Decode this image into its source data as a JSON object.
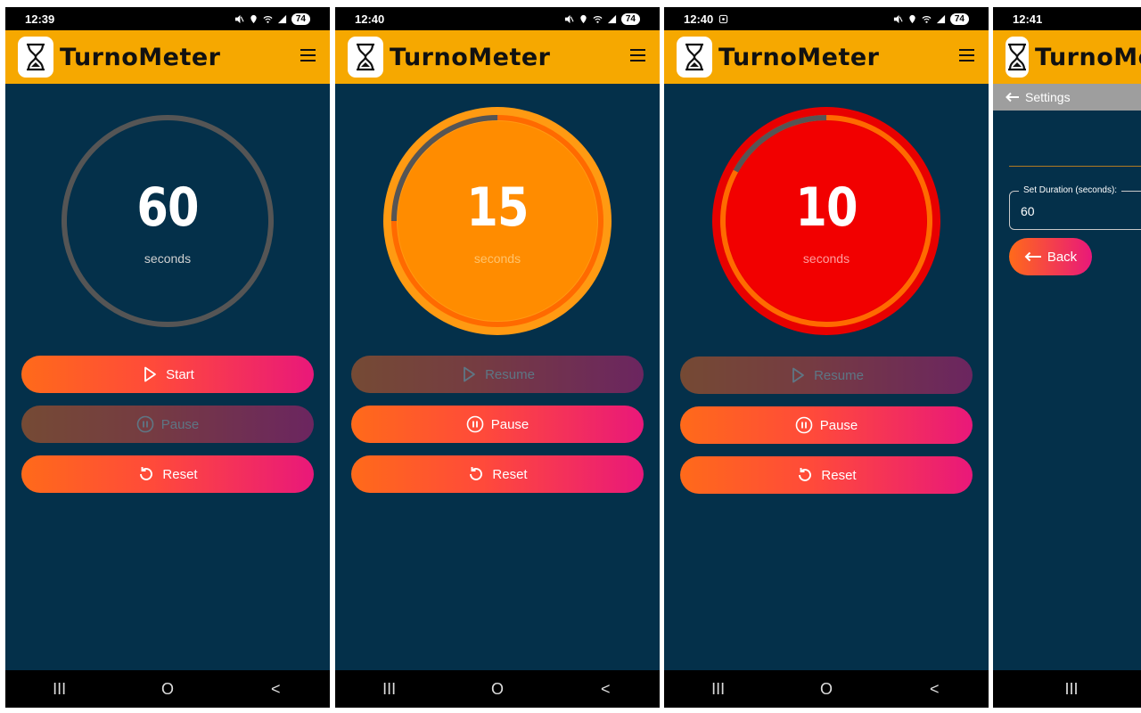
{
  "app_title": "TurnoMeter",
  "colors": {
    "background": "#04304a",
    "appbar": "#f6a800",
    "orange_state": "#ff8c00",
    "red_state": "#f20000",
    "track_gray": "#555555"
  },
  "screens": [
    {
      "status_time": "12:39",
      "battery": "74",
      "timer": {
        "value": "60",
        "unit": "seconds",
        "state": "idle",
        "progress_remaining": 1.0
      },
      "buttons": {
        "primary_label": "Start",
        "primary_icon": "play-icon",
        "pause_label": "Pause",
        "reset_label": "Reset"
      }
    },
    {
      "status_time": "12:40",
      "battery": "74",
      "timer": {
        "value": "15",
        "unit": "seconds",
        "state": "warning",
        "progress_remaining": 0.25
      },
      "buttons": {
        "primary_label": "Resume",
        "primary_icon": "play-icon",
        "pause_label": "Pause",
        "reset_label": "Reset"
      }
    },
    {
      "status_time": "12:40",
      "battery": "74",
      "timer": {
        "value": "10",
        "unit": "seconds",
        "state": "danger",
        "progress_remaining": 0.17
      },
      "buttons": {
        "primary_label": "Resume",
        "primary_icon": "play-icon",
        "pause_label": "Pause",
        "reset_label": "Reset"
      }
    },
    {
      "status_time": "12:41",
      "settings_title": "Settings",
      "duration_label": "Set Duration (seconds):",
      "duration_value": "60",
      "back_label": "Back"
    }
  ],
  "nav": {
    "recents": "III",
    "home": "O",
    "back": "<"
  }
}
